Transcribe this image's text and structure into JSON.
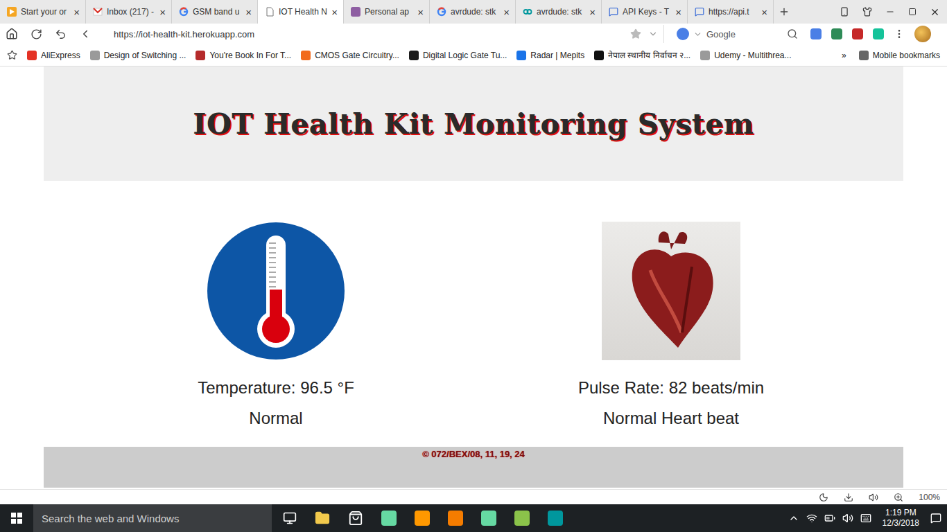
{
  "browser": {
    "tabs": [
      {
        "label": "Start your or",
        "close": "×",
        "selected": false
      },
      {
        "label": "Inbox (217) -",
        "close": "×",
        "selected": false
      },
      {
        "label": "GSM band u",
        "close": "×",
        "selected": false
      },
      {
        "label": "IOT Health N",
        "close": "×",
        "selected": true
      },
      {
        "label": "Personal ap",
        "close": "×",
        "selected": false
      },
      {
        "label": "avrdude: stk",
        "close": "×",
        "selected": false
      },
      {
        "label": "avrdude: stk",
        "close": "×",
        "selected": false
      },
      {
        "label": "API Keys - T",
        "close": "×",
        "selected": false
      },
      {
        "label": "https://api.t",
        "close": "×",
        "selected": false
      }
    ],
    "address": "https://iot-health-kit.herokuapp.com",
    "search": {
      "engine": "Google"
    },
    "bookmarks": [
      "AliExpress",
      "Design of Switching ...",
      "You're Book In For T...",
      "CMOS Gate Circuitry...",
      "Digital Logic Gate Tu...",
      "Radar | Mepits",
      "नेपाल स्थानीय निर्वाचन २...",
      "Udemy - Multithrea..."
    ],
    "bookmarks_more": "»",
    "mobile_bookmarks": "Mobile bookmarks",
    "zoom": "100%"
  },
  "page": {
    "title": "IOT Health Kit Monitoring System",
    "cards": [
      {
        "kind": "temperature",
        "reading": "Temperature: 96.5 °F",
        "status": "Normal"
      },
      {
        "kind": "pulse",
        "reading": "Pulse Rate: 82 beats/min",
        "status": "Normal Heart beat"
      }
    ],
    "footer": "© 072/BEX/08, 11, 19, 24"
  },
  "taskbar": {
    "search_placeholder": "Search the web and Windows",
    "time": "1:19 PM",
    "date": "12/3/2018"
  }
}
